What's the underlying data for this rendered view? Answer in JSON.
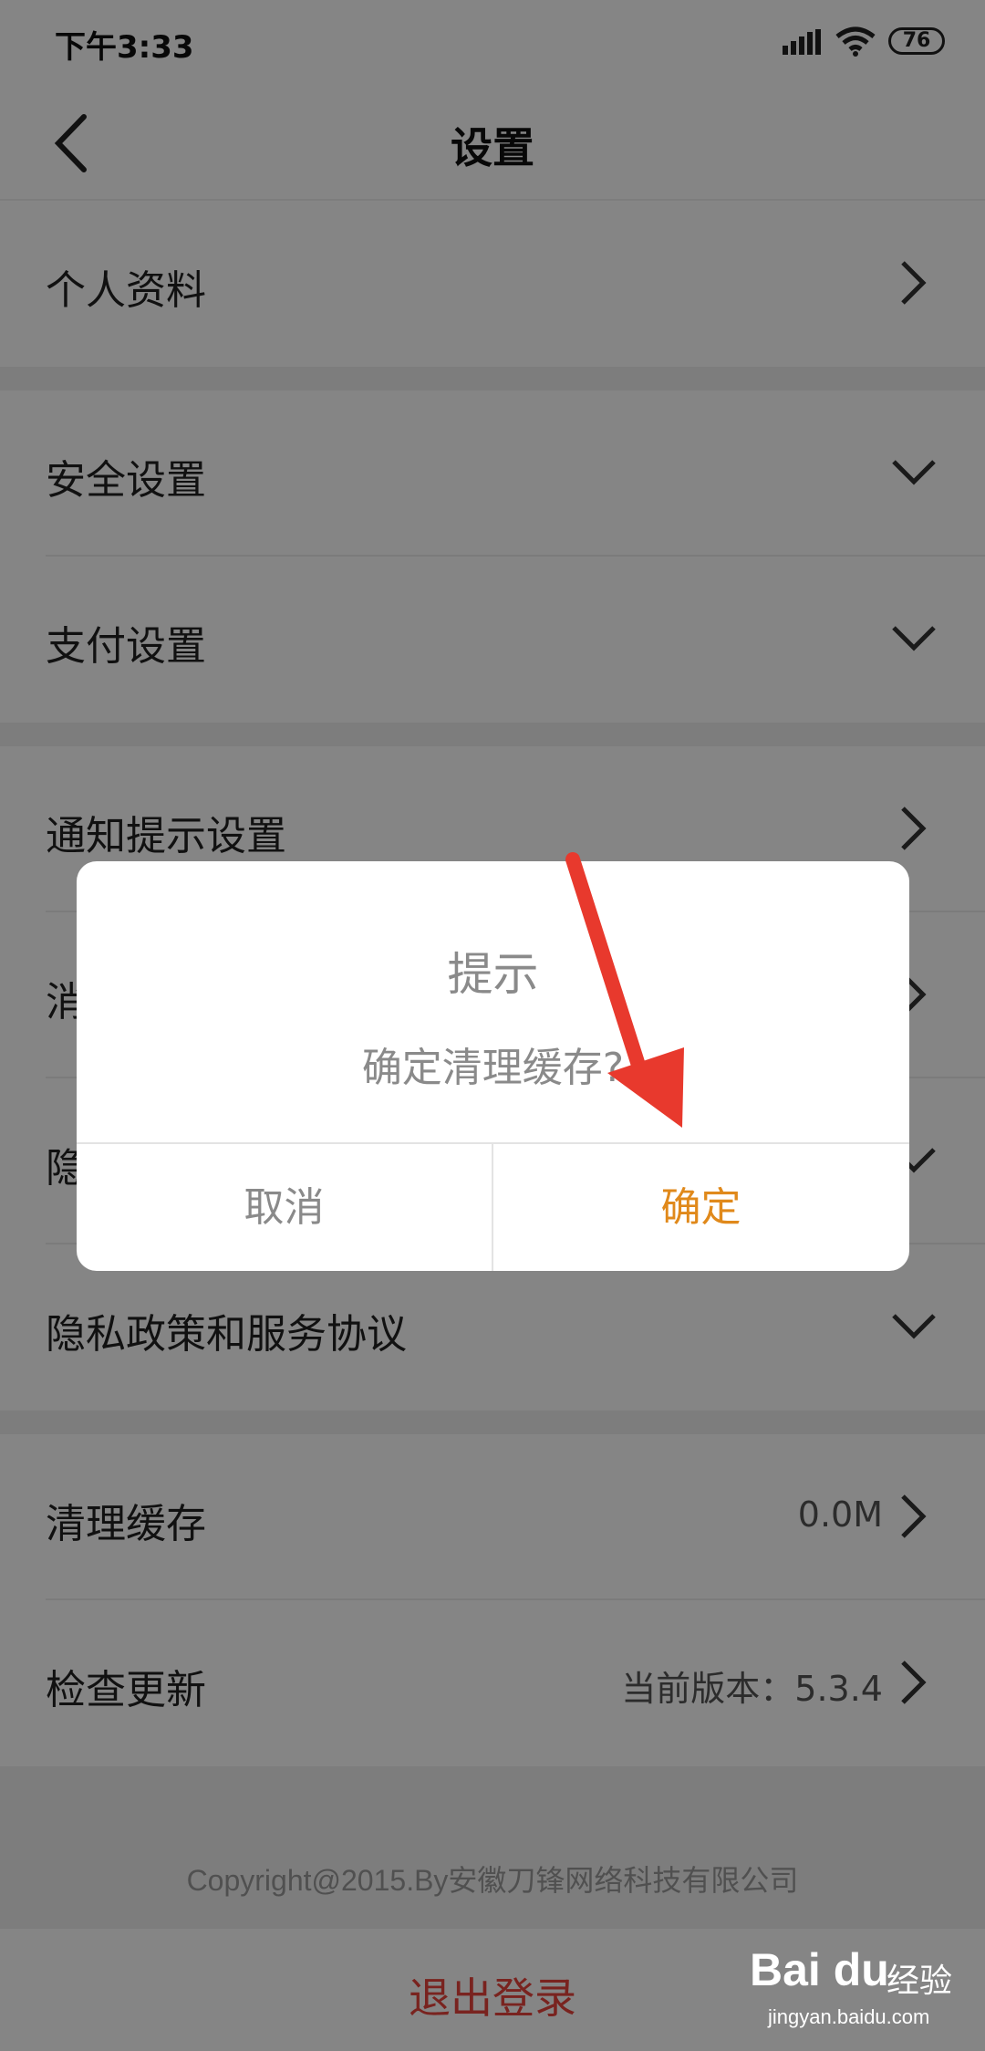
{
  "status_bar": {
    "time": "下午3:33",
    "battery": "76",
    "icons": [
      "signal-icon",
      "wifi-icon",
      "battery-icon"
    ]
  },
  "header": {
    "title": "设置",
    "back_icon": "chevron-left-icon"
  },
  "rows": [
    {
      "label": "个人资料",
      "icon": "chevron-right-icon"
    },
    {
      "label": "安全设置",
      "icon": "chevron-down-icon"
    },
    {
      "label": "支付设置",
      "icon": "chevron-down-icon"
    },
    {
      "label": "通知提示设置",
      "icon": "chevron-right-icon"
    },
    {
      "label": "消",
      "icon": "chevron-right-icon"
    },
    {
      "label": "隐",
      "icon": "chevron-down-icon"
    },
    {
      "label": "隐私政策和服务协议",
      "icon": "chevron-down-icon"
    },
    {
      "label": "清理缓存",
      "value": "0.0M",
      "icon": "chevron-right-icon"
    },
    {
      "label": "检查更新",
      "value": "当前版本：5.3.4",
      "icon": "chevron-right-icon"
    }
  ],
  "footer": {
    "copyright": "Copyright@2015.By安徽刀锋网络科技有限公司",
    "logout_label": "退出登录"
  },
  "dialog": {
    "title": "提示",
    "message": "确定清理缓存?",
    "cancel_label": "取消",
    "confirm_label": "确定"
  },
  "watermark": {
    "logo": "Bai du",
    "text": "经验",
    "url": "jingyan.baidu.com"
  },
  "colors": {
    "accent": "#e0891b",
    "logout": "#e8443c",
    "arrow": "#e8392d"
  }
}
